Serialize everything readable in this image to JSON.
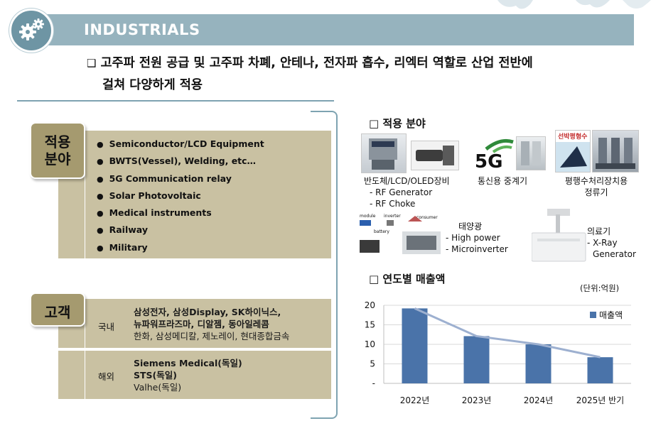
{
  "header": {
    "title": "INDUSTRIALS"
  },
  "intro": {
    "bullet": "❑",
    "line1": "고주파 전원 공급 및 고주파 차폐, 안테나, 전자파 흡수, 리엑터 역할로 산업 전반에",
    "line2": "걸쳐 다양하게 적용"
  },
  "applications_tag": {
    "line1": "적용",
    "line2": "분야"
  },
  "applications": [
    "Semiconductor/LCD Equipment",
    "BWTS(Vessel), Welding, etc…",
    "5G Communication relay",
    "Solar Photovoltaic",
    "Medical instruments",
    "Railway",
    "Military"
  ],
  "customers": {
    "tag": "고객",
    "domestic_label": "국내",
    "domestic_line1": "삼성전자, 삼성Display, SK하이닉스,",
    "domestic_line2": "뉴파워프라즈마, 디알젬, 동아일레콤",
    "domestic_line3": "한화, 삼성메디칼, 제노레이, 현대종합금속",
    "overseas_label": "해외",
    "overseas_line1": "Siemens Medical(독일)",
    "overseas_line2": "STS(독일)",
    "overseas_line3": "Valhe(독일)"
  },
  "app_section": {
    "title": "□ 적용 분야",
    "semi": {
      "title": "반도체/LCD/OLED장비",
      "item1": "- RF Generator",
      "item2": "- RF Choke"
    },
    "telecom": {
      "title": "통신용 중계기",
      "logo_text": "5G"
    },
    "ballast": {
      "line1": "평행수처리장치용",
      "line2": "정류기",
      "sign": "선박평형수"
    },
    "solar": {
      "title": "태양광",
      "item1": "- High power",
      "item2": "- Microinverter",
      "diagram1": "module",
      "diagram2": "inverter",
      "diagram3": "consumer",
      "diagram4": "battery"
    },
    "medical": {
      "title": "의료기",
      "item1": "- X-Ray",
      "item2": "Generator"
    }
  },
  "sales_section": {
    "title": "□ 연도별 매출액",
    "unit": "(단위:억원)"
  },
  "chart_data": {
    "type": "bar",
    "categories": [
      "2022년",
      "2023년",
      "2024년",
      "2025년 반기"
    ],
    "series": [
      {
        "name": "매출액",
        "values": [
          19.2,
          12.1,
          10,
          6.7
        ]
      }
    ],
    "trend_line": true,
    "ylim": [
      0,
      20
    ],
    "yticks": [
      "-",
      "5",
      "10",
      "15",
      "20"
    ],
    "legend_position": "top-right",
    "bar_color": "#4a73a9",
    "trend_color": "#9db0d0"
  }
}
